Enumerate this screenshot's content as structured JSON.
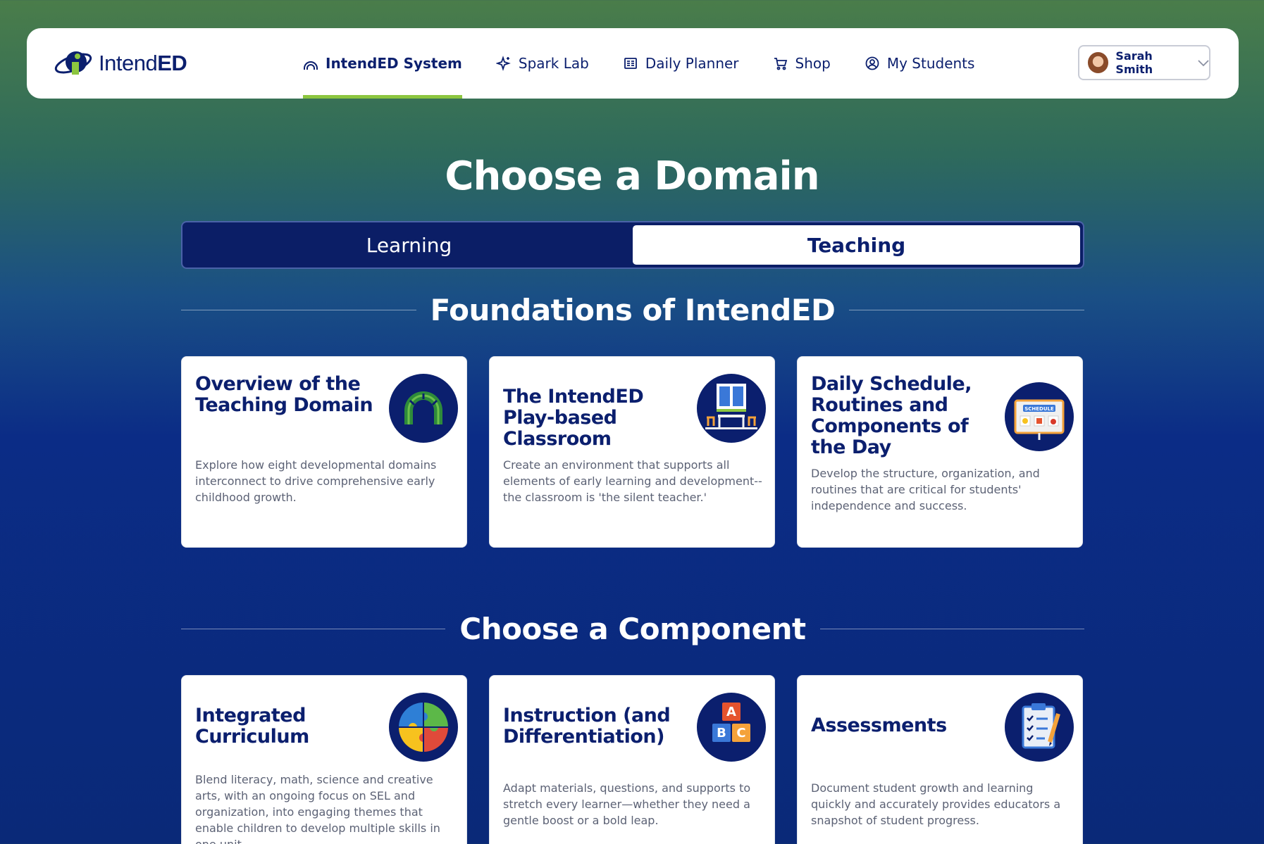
{
  "brand": {
    "name_regular": "Intend",
    "name_bold": "ED"
  },
  "nav": {
    "items": [
      {
        "label": "IntendED System",
        "icon": "rainbow-icon",
        "active": true
      },
      {
        "label": "Spark Lab",
        "icon": "sparkle-icon",
        "active": false
      },
      {
        "label": "Daily Planner",
        "icon": "planner-icon",
        "active": false
      },
      {
        "label": "Shop",
        "icon": "cart-icon",
        "active": false
      },
      {
        "label": "My Students",
        "icon": "user-circle-icon",
        "active": false
      }
    ],
    "user": {
      "name": "Sarah Smith"
    }
  },
  "page": {
    "title": "Choose a Domain",
    "tabs": [
      {
        "label": "Learning",
        "selected": false
      },
      {
        "label": "Teaching",
        "selected": true
      }
    ]
  },
  "foundations": {
    "heading": "Foundations of IntendED",
    "cards": [
      {
        "title": "Overview of the Teaching Domain",
        "description": "Explore how eight developmental domains interconnect to drive comprehensive early childhood growth.",
        "icon": "rainbow-arch-icon"
      },
      {
        "title": "The IntendED Play-based Classroom",
        "description": "Create an environment that supports all elements of early learning and development--the classroom is 'the silent teacher.'",
        "icon": "classroom-icon"
      },
      {
        "title": "Daily Schedule, Routines and Components of the Day",
        "description": "Develop the structure, organization, and routines that are critical for students' independence and success.",
        "icon": "schedule-board-icon",
        "icon_text": "SCHEDULE"
      }
    ]
  },
  "components": {
    "heading": "Choose a Component",
    "cards": [
      {
        "title": "Integrated Curriculum",
        "description": "Blend literacy, math, science and creative arts, with an ongoing focus on SEL and organization, into engaging themes that enable children to develop multiple skills in one unit.",
        "icon": "puzzle-icon"
      },
      {
        "title": "Instruction (and Differentiation)",
        "description": "Adapt materials, questions, and supports to stretch every learner—whether they need a gentle boost or a bold leap.",
        "icon": "abc-blocks-icon",
        "icon_letters": [
          "A",
          "B",
          "C"
        ]
      },
      {
        "title": "Assessments",
        "description": "Document student growth and learning quickly and accurately provides educators a snapshot of student progress.",
        "icon": "clipboard-checklist-icon"
      }
    ]
  },
  "colors": {
    "navy": "#0b1f6e",
    "accent_green": "#8cc63f",
    "card_text": "#5c6275"
  }
}
